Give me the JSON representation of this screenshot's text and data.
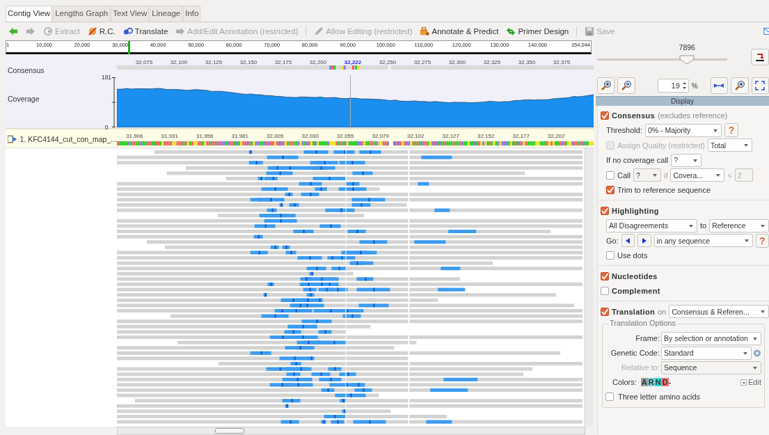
{
  "tabs": [
    {
      "label": "Contig View",
      "selected": true
    },
    {
      "label": "Lengths Graph",
      "selected": false
    },
    {
      "label": "Text View",
      "selected": false
    },
    {
      "label": "Lineage",
      "selected": false
    },
    {
      "label": "Info",
      "selected": false
    }
  ],
  "toolbar": [
    {
      "kind": "back",
      "disabled": false
    },
    {
      "kind": "forward",
      "disabled": true
    },
    {
      "kind": "extract",
      "label": "Extract",
      "disabled": true
    },
    {
      "kind": "rc",
      "label": "R.C.",
      "disabled": false
    },
    {
      "kind": "translate",
      "label": "Translate",
      "disabled": false
    },
    {
      "kind": "annotation",
      "label": "Add/Edit Annotation (restricted)",
      "disabled": true
    },
    {
      "kind": "separator"
    },
    {
      "kind": "edit",
      "label": "Allow Editing (restricted)",
      "disabled": true
    },
    {
      "kind": "annotate",
      "label": "Annotate & Predict",
      "disabled": false
    },
    {
      "kind": "primer",
      "label": "Primer Design",
      "disabled": false
    },
    {
      "kind": "separator"
    },
    {
      "kind": "save",
      "label": "Save",
      "disabled": true
    },
    {
      "kind": "mail",
      "disabled": false
    }
  ],
  "overview_ruler": {
    "labels": [
      "1",
      "10,000",
      "20,000",
      "30,000",
      "40,000",
      "50,000",
      "60,000",
      "70,000",
      "80,000",
      "90,000",
      "100,000",
      "110,000",
      "120,000",
      "130,000",
      "140,000"
    ],
    "end_label": "154,044",
    "view_marker": {
      "level": 0.208
    }
  },
  "consensus_track": {
    "label": "Consensus",
    "ticks": [
      {
        "label": "32,075",
        "selected": false
      },
      {
        "label": "32,100",
        "selected": false
      },
      {
        "label": "32,125",
        "selected": false
      },
      {
        "label": "32,150",
        "selected": false
      },
      {
        "label": "32,175",
        "selected": false
      },
      {
        "label": "32,200",
        "selected": false
      },
      {
        "label": "32,222",
        "selected": true
      },
      {
        "label": "32,250",
        "selected": false
      },
      {
        "label": "32,275",
        "selected": false
      },
      {
        "label": "32,300",
        "selected": false
      },
      {
        "label": "32,325",
        "selected": false
      },
      {
        "label": "32,350",
        "selected": false
      },
      {
        "label": "32,375",
        "selected": false
      }
    ]
  },
  "coverage": {
    "label": "Coverage",
    "axis_max": "181",
    "axis_min": "0"
  },
  "sequence": {
    "name": "1. KFC4144_cut_con_map_...",
    "ticks": [
      "31,906",
      "31,931",
      "31,956",
      "31,981",
      "32,005",
      "32,030",
      "32,055",
      "32,079",
      "32,102",
      "32,127",
      "32,152",
      "32,177",
      "32,202"
    ]
  },
  "view_slider": {
    "value": "7896",
    "level": 0.69
  },
  "zoom": {
    "value": "19",
    "unit": "%"
  },
  "display_header": "Display",
  "consensus": {
    "checked": true,
    "title": "Consensus",
    "note": "(excludes reference)",
    "threshold_label": "Threshold:",
    "threshold": "0% - Majority",
    "help": "?",
    "assign_quality": {
      "label": "Assign Quality (restricted)",
      "checked": false,
      "disabled": true,
      "value": "Total"
    },
    "no_coverage_label": "If no coverage call",
    "no_coverage_value": "?",
    "call": {
      "checked": false,
      "label": "Call",
      "value": "?",
      "if_label": "if",
      "condition": "Covera...",
      "less_than": "<",
      "limit": "2"
    },
    "trim": {
      "checked": true,
      "label": "Trim to reference sequence"
    }
  },
  "highlighting": {
    "checked": true,
    "title": "Highlighting",
    "mode": "All Disagreements",
    "to_label": "to",
    "target": "Reference",
    "go_label": "Go:",
    "scope": "in any sequence",
    "help": "?",
    "use_dots": {
      "checked": false,
      "label": "Use dots"
    }
  },
  "nucleotides": {
    "checked": true,
    "title": "Nucleotides"
  },
  "complement": {
    "checked": false,
    "title": "Complement"
  },
  "translation": {
    "checked": true,
    "title": "Translation",
    "on_label": "on",
    "source": "Consensus & Referen...",
    "options_title": "Translation Options",
    "frame_label": "Frame:",
    "frame": "By selection or annotation",
    "genetic_code_label": "Genetic Code:",
    "genetic_code": "Standard",
    "relative_label": "Relative to:",
    "relative_disabled": true,
    "relative": "Sequence",
    "colors_label": "Colors:",
    "colors": [
      {
        "letter": "A",
        "color": "#9aa0a0"
      },
      {
        "letter": "R",
        "color": "#80d0d0"
      },
      {
        "letter": "N",
        "color": "#20e0e0"
      },
      {
        "letter": "D",
        "color": "#f07070"
      }
    ],
    "gap_char": "-",
    "edit": "Edit",
    "three_letter": {
      "checked": false,
      "label": "Three letter amino acids"
    }
  }
}
